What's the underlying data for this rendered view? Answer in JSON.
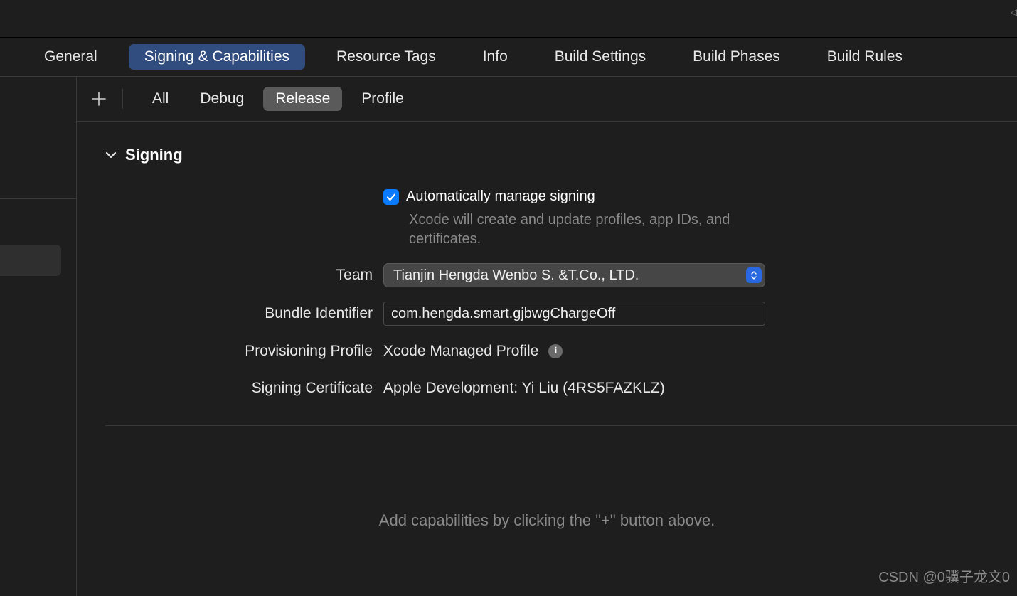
{
  "tabs": {
    "general": "General",
    "signing": "Signing & Capabilities",
    "resource_tags": "Resource Tags",
    "info": "Info",
    "build_settings": "Build Settings",
    "build_phases": "Build Phases",
    "build_rules": "Build Rules"
  },
  "filters": {
    "all": "All",
    "debug": "Debug",
    "release": "Release",
    "profile": "Profile"
  },
  "signing": {
    "section_title": "Signing",
    "auto_manage_label": "Automatically manage signing",
    "auto_manage_help": "Xcode will create and update profiles, app IDs, and certificates.",
    "team_label": "Team",
    "team_value": "Tianjin Hengda Wenbo S. &T.Co., LTD.",
    "bundle_label": "Bundle Identifier",
    "bundle_value": "com.hengda.smart.gjbwgChargeOff",
    "profile_label": "Provisioning Profile",
    "profile_value": "Xcode Managed Profile",
    "cert_label": "Signing Certificate",
    "cert_value": "Apple Development: Yi Liu (4RS5FAZKLZ)"
  },
  "empty_capabilities_msg": "Add capabilities by clicking the \"+\" button above.",
  "watermark": "CSDN @0骥子龙文0"
}
